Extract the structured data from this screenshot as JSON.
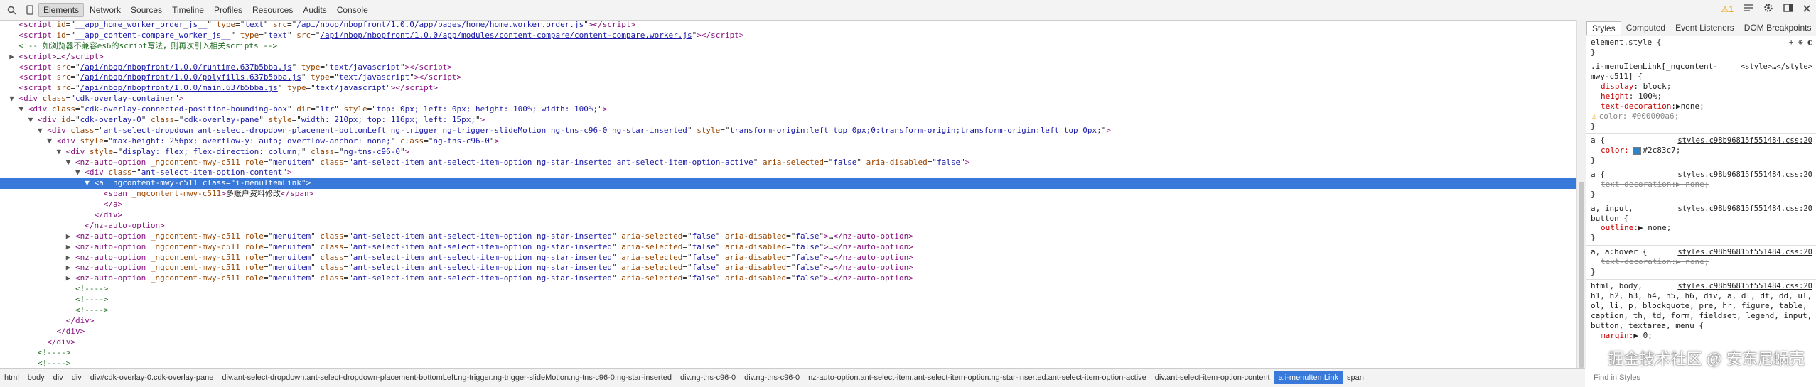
{
  "toolbar": {
    "tabs": [
      "Elements",
      "Network",
      "Sources",
      "Timeline",
      "Profiles",
      "Resources",
      "Audits",
      "Console"
    ],
    "warnings": "1"
  },
  "styles_tabs": [
    "Styles",
    "Computed",
    "Event Listeners",
    "DOM Breakpoints"
  ],
  "dom": [
    {
      "indent": 2,
      "tri": "",
      "html": "<span class='tg'>&lt;script</span> <span class='an'>id</span>=\"<span class='av'>__app_home_worker_order_js__</span>\" <span class='an'>type</span>=\"<span class='av'>text</span>\" <span class='an'>src</span>=\"<span class='lk'>/api/nbop/nbopfront/1.0.0/app/pages/home/home.worker.order.js</span>\"<span class='tg'>&gt;&lt;/script&gt;</span>"
    },
    {
      "indent": 2,
      "tri": "",
      "html": "<span class='tg'>&lt;script</span> <span class='an'>id</span>=\"<span class='av'>__app_content-compare_worker_js__</span>\" <span class='an'>type</span>=\"<span class='av'>text</span>\" <span class='an'>src</span>=\"<span class='lk'>/api/nbop/nbopfront/1.0.0/app/modules/content-compare/content-compare.worker.js</span>\"<span class='tg'>&gt;&lt;/script&gt;</span>"
    },
    {
      "indent": 2,
      "tri": "",
      "html": "<span class='cm'>&lt;!-- 如浏览器不兼容es6的script写法，则再次引入相关scripts --&gt;</span>"
    },
    {
      "indent": 2,
      "tri": "▶",
      "html": "<span class='tg'>&lt;script&gt;</span>…<span class='tg'>&lt;/script&gt;</span>"
    },
    {
      "indent": 2,
      "tri": "",
      "html": "<span class='tg'>&lt;script</span> <span class='an'>src</span>=\"<span class='lk'>/api/nbop/nbopfront/1.0.0/runtime.637b5bba.js</span>\" <span class='an'>type</span>=\"<span class='av'>text/javascript</span>\"<span class='tg'>&gt;&lt;/script&gt;</span>"
    },
    {
      "indent": 2,
      "tri": "",
      "html": "<span class='tg'>&lt;script</span> <span class='an'>src</span>=\"<span class='lk'>/api/nbop/nbopfront/1.0.0/polyfills.637b5bba.js</span>\" <span class='an'>type</span>=\"<span class='av'>text/javascript</span>\"<span class='tg'>&gt;&lt;/script&gt;</span>"
    },
    {
      "indent": 2,
      "tri": "",
      "html": "<span class='tg'>&lt;script</span> <span class='an'>src</span>=\"<span class='lk'>/api/nbop/nbopfront/1.0.0/main.637b5bba.js</span>\" <span class='an'>type</span>=\"<span class='av'>text/javascript</span>\"<span class='tg'>&gt;&lt;/script&gt;</span>"
    },
    {
      "indent": 2,
      "tri": "▼",
      "html": "<span class='tg'>&lt;div</span> <span class='an'>class</span>=\"<span class='av'>cdk-overlay-container</span>\"<span class='tg'>&gt;</span>"
    },
    {
      "indent": 4,
      "tri": "▼",
      "html": "<span class='tg'>&lt;div</span> <span class='an'>class</span>=\"<span class='av'>cdk-overlay-connected-position-bounding-box</span>\" <span class='an'>dir</span>=\"<span class='av'>ltr</span>\" <span class='an'>style</span>=\"<span class='av'>top: 0px; left: 0px; height: 100%; width: 100%;</span>\"<span class='tg'>&gt;</span>"
    },
    {
      "indent": 6,
      "tri": "▼",
      "html": "<span class='tg'>&lt;div</span> <span class='an'>id</span>=\"<span class='av'>cdk-overlay-0</span>\" <span class='an'>class</span>=\"<span class='av'>cdk-overlay-pane</span>\" <span class='an'>style</span>=\"<span class='av'>width: 210px; top: 116px; left: 15px;</span>\"<span class='tg'>&gt;</span>"
    },
    {
      "indent": 8,
      "tri": "▼",
      "html": "<span class='tg'>&lt;div</span> <span class='an'>class</span>=\"<span class='av'>ant-select-dropdown ant-select-dropdown-placement-bottomLeft ng-trigger ng-trigger-slideMotion ng-tns-c96-0 ng-star-inserted</span>\" <span class='an'>style</span>=\"<span class='av'>transform-origin:left top 0px;0:transform-origin;transform-origin:left top 0px;</span>\"<span class='tg'>&gt;</span>"
    },
    {
      "indent": 10,
      "tri": "▼",
      "html": "<span class='tg'>&lt;div</span> <span class='an'>style</span>=\"<span class='av'>max-height: 256px; overflow-y: auto; overflow-anchor: none;</span>\" <span class='an'>class</span>=\"<span class='av'>ng-tns-c96-0</span>\"<span class='tg'>&gt;</span>"
    },
    {
      "indent": 12,
      "tri": "▼",
      "html": "<span class='tg'>&lt;div</span> <span class='an'>style</span>=\"<span class='av'>display: flex; flex-direction: column;</span>\" <span class='an'>class</span>=\"<span class='av'>ng-tns-c96-0</span>\"<span class='tg'>&gt;</span>"
    },
    {
      "indent": 14,
      "tri": "▼",
      "html": "<span class='tg'>&lt;nz-auto-option</span> <span class='an'>_ngcontent-mwy-c511</span> <span class='an'>role</span>=\"<span class='av'>menuitem</span>\" <span class='an'>class</span>=\"<span class='av'>ant-select-item ant-select-item-option ng-star-inserted ant-select-item-option-active</span>\" <span class='an'>aria-selected</span>=\"<span class='av'>false</span>\" <span class='an'>aria-disabled</span>=\"<span class='av'>false</span>\"<span class='tg'>&gt;</span>"
    },
    {
      "indent": 16,
      "tri": "▼",
      "html": "<span class='tg'>&lt;div</span> <span class='an'>class</span>=\"<span class='av'>ant-select-item-option-content</span>\"<span class='tg'>&gt;</span>"
    },
    {
      "indent": 18,
      "tri": "▼",
      "sel": true,
      "html": "<span class='tg'>&lt;a</span> <span class='an'>_ngcontent-mwy-c511</span> <span class='an'>class</span>=\"<span class='av'>i-menuItemLink</span>\"<span class='tg'>&gt;</span>"
    },
    {
      "indent": 20,
      "tri": "",
      "html": "<span class='tg'>&lt;span</span> <span class='an'>_ngcontent-mwy-c511</span><span class='tg'>&gt;</span><span class='tx'>多账户资料修改</span><span class='tg'>&lt;/span&gt;</span>"
    },
    {
      "indent": 20,
      "tri": "",
      "html": "<span class='tg'>&lt;/a&gt;</span>"
    },
    {
      "indent": 18,
      "tri": "",
      "html": "<span class='tg'>&lt;/div&gt;</span>"
    },
    {
      "indent": 16,
      "tri": "",
      "html": "<span class='tg'>&lt;/nz-auto-option&gt;</span>"
    },
    {
      "indent": 14,
      "tri": "▶",
      "html": "<span class='tg'>&lt;nz-auto-option</span> <span class='an'>_ngcontent-mwy-c511</span> <span class='an'>role</span>=\"<span class='av'>menuitem</span>\" <span class='an'>class</span>=\"<span class='av'>ant-select-item ant-select-item-option ng-star-inserted</span>\" <span class='an'>aria-selected</span>=\"<span class='av'>false</span>\" <span class='an'>aria-disabled</span>=\"<span class='av'>false</span>\"<span class='tg'>&gt;</span>…<span class='tg'>&lt;/nz-auto-option&gt;</span>"
    },
    {
      "indent": 14,
      "tri": "▶",
      "html": "<span class='tg'>&lt;nz-auto-option</span> <span class='an'>_ngcontent-mwy-c511</span> <span class='an'>role</span>=\"<span class='av'>menuitem</span>\" <span class='an'>class</span>=\"<span class='av'>ant-select-item ant-select-item-option ng-star-inserted</span>\" <span class='an'>aria-selected</span>=\"<span class='av'>false</span>\" <span class='an'>aria-disabled</span>=\"<span class='av'>false</span>\"<span class='tg'>&gt;</span>…<span class='tg'>&lt;/nz-auto-option&gt;</span>"
    },
    {
      "indent": 14,
      "tri": "▶",
      "html": "<span class='tg'>&lt;nz-auto-option</span> <span class='an'>_ngcontent-mwy-c511</span> <span class='an'>role</span>=\"<span class='av'>menuitem</span>\" <span class='an'>class</span>=\"<span class='av'>ant-select-item ant-select-item-option ng-star-inserted</span>\" <span class='an'>aria-selected</span>=\"<span class='av'>false</span>\" <span class='an'>aria-disabled</span>=\"<span class='av'>false</span>\"<span class='tg'>&gt;</span>…<span class='tg'>&lt;/nz-auto-option&gt;</span>"
    },
    {
      "indent": 14,
      "tri": "▶",
      "html": "<span class='tg'>&lt;nz-auto-option</span> <span class='an'>_ngcontent-mwy-c511</span> <span class='an'>role</span>=\"<span class='av'>menuitem</span>\" <span class='an'>class</span>=\"<span class='av'>ant-select-item ant-select-item-option ng-star-inserted</span>\" <span class='an'>aria-selected</span>=\"<span class='av'>false</span>\" <span class='an'>aria-disabled</span>=\"<span class='av'>false</span>\"<span class='tg'>&gt;</span>…<span class='tg'>&lt;/nz-auto-option&gt;</span>"
    },
    {
      "indent": 14,
      "tri": "▶",
      "html": "<span class='tg'>&lt;nz-auto-option</span> <span class='an'>_ngcontent-mwy-c511</span> <span class='an'>role</span>=\"<span class='av'>menuitem</span>\" <span class='an'>class</span>=\"<span class='av'>ant-select-item ant-select-item-option ng-star-inserted</span>\" <span class='an'>aria-selected</span>=\"<span class='av'>false</span>\" <span class='an'>aria-disabled</span>=\"<span class='av'>false</span>\"<span class='tg'>&gt;</span>…<span class='tg'>&lt;/nz-auto-option&gt;</span>"
    },
    {
      "indent": 14,
      "tri": "",
      "html": "<span class='cm'>&lt;!----&gt;</span>"
    },
    {
      "indent": 14,
      "tri": "",
      "html": "<span class='cm'>&lt;!----&gt;</span>"
    },
    {
      "indent": 14,
      "tri": "",
      "html": "<span class='cm'>&lt;!----&gt;</span>"
    },
    {
      "indent": 12,
      "tri": "",
      "html": "<span class='tg'>&lt;/div&gt;</span>"
    },
    {
      "indent": 10,
      "tri": "",
      "html": "<span class='tg'>&lt;/div&gt;</span>"
    },
    {
      "indent": 8,
      "tri": "",
      "html": "<span class='tg'>&lt;/div&gt;</span>"
    },
    {
      "indent": 6,
      "tri": "",
      "html": "<span class='cm'>&lt;!----&gt;</span>"
    },
    {
      "indent": 6,
      "tri": "",
      "html": "<span class='cm'>&lt;!----&gt;</span>"
    }
  ],
  "crumbs": [
    "html",
    "body",
    "div",
    "div",
    "div#cdk-overlay-0.cdk-overlay-pane",
    "div.ant-select-dropdown.ant-select-dropdown-placement-bottomLeft.ng-trigger.ng-trigger-slideMotion.ng-tns-c96-0.ng-star-inserted",
    "div.ng-tns-c96-0",
    "div.ng-tns-c96-0",
    "nz-auto-option.ant-select-item.ant-select-item-option.ng-star-inserted.ant-select-item-option-active",
    "div.ant-select-item-option-content",
    "a.i-menuItemLink",
    "span"
  ],
  "crumb_selected": 10,
  "styles": {
    "element_style": "element.style {",
    "rule1": {
      "selector": ".i-menuItemLink[_ngcontent-mwy-c511] {",
      "source": "<style>…</style>",
      "props": [
        [
          "display",
          "block;"
        ],
        [
          "height",
          "100%;"
        ],
        [
          "text-decoration",
          "▶none;"
        ]
      ],
      "struck": "color: #000000a6;"
    },
    "rule2": {
      "selector": "a {",
      "source": "styles.c98b96815f551484.css:20",
      "prop": "color:",
      "value": "#2c83c7;",
      "swatch": "#2c83c7"
    },
    "rule3": {
      "selector": "a {",
      "source": "styles.c98b96815f551484.css:20",
      "struck": "text-decoration:▶ none;"
    },
    "rule4": {
      "selector": "a, input,",
      "selector2": "button {",
      "source": "styles.c98b96815f551484.css:20",
      "prop": "outline:",
      "value": "▶ none;"
    },
    "rule5": {
      "selector": "a, a:hover {",
      "source": "styles.c98b96815f551484.css:20",
      "struck": "text-decoration:▶ none;"
    },
    "rule6": {
      "selector": "html, body,",
      "source": "styles.c98b96815f551484.css:20",
      "text": "h1, h2, h3, h4, h5, h6, div, a, dl, dt, dd, ul, ol, li, p, blockquote, pre, hr, figure, table, caption, th, td, form, fieldset, legend, input, button, textarea, menu {",
      "prop": "margin:",
      "value": "▶ 0;"
    },
    "filter_placeholder": "Find in Styles"
  },
  "watermark": "掘金技术社区 @ 安东尼蜗壳"
}
